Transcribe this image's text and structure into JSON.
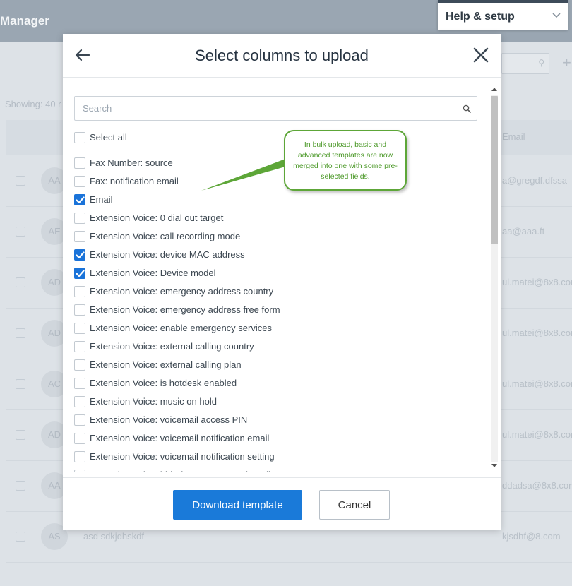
{
  "background": {
    "app_title": "Manager",
    "showing_text": "Showing: 40 r",
    "email_column_header": "Email",
    "rows": [
      {
        "avatar": "AA",
        "name": "",
        "email": "a@gregdf.dfssa"
      },
      {
        "avatar": "AE",
        "name": "",
        "email": "aa@aaa.ft"
      },
      {
        "avatar": "AD",
        "name": "",
        "email": "ul.matei@8x8.com"
      },
      {
        "avatar": "AD",
        "name": "",
        "email": "ul.matei@8x8.com"
      },
      {
        "avatar": "AC",
        "name": "",
        "email": "ul.matei@8x8.com"
      },
      {
        "avatar": "AD",
        "name": "",
        "email": "ul.matei@8x8.com"
      },
      {
        "avatar": "AA",
        "name": "",
        "email": "ddadsa@8x8.com"
      },
      {
        "avatar": "AS",
        "name": "asd sdkjdhskdf",
        "email": "kjsdhf@8.com"
      }
    ]
  },
  "help_menu": {
    "label": "Help & setup"
  },
  "modal": {
    "title": "Select columns to upload",
    "search_placeholder": "Search",
    "select_all_label": "Select all",
    "items": [
      {
        "label": "Fax Number: source",
        "checked": false
      },
      {
        "label": "Fax: notification email",
        "checked": false
      },
      {
        "label": "Email",
        "checked": true
      },
      {
        "label": "Extension Voice: 0 dial out target",
        "checked": false
      },
      {
        "label": "Extension Voice: call recording mode",
        "checked": false
      },
      {
        "label": "Extension Voice: device MAC address",
        "checked": true
      },
      {
        "label": "Extension Voice: Device model",
        "checked": true
      },
      {
        "label": "Extension Voice: emergency address country",
        "checked": false
      },
      {
        "label": "Extension Voice: emergency address free form",
        "checked": false
      },
      {
        "label": "Extension Voice: enable emergency services",
        "checked": false
      },
      {
        "label": "Extension Voice: external calling country",
        "checked": false
      },
      {
        "label": "Extension Voice: external calling plan",
        "checked": false
      },
      {
        "label": "Extension Voice: is hotdesk enabled",
        "checked": false
      },
      {
        "label": "Extension Voice: music on hold",
        "checked": false
      },
      {
        "label": "Extension Voice: voicemail access PIN",
        "checked": false
      },
      {
        "label": "Extension Voice: voicemail notification email",
        "checked": false
      },
      {
        "label": "Extension Voice: voicemail notification setting",
        "checked": false
      },
      {
        "label": "Extension Voice: hide from Auto Attendant directory",
        "checked": false
      }
    ],
    "download_button": "Download template",
    "cancel_button": "Cancel"
  },
  "callout": {
    "text": "In bulk upload, basic and advanced templates are now merged into one with some pre-selected fields."
  },
  "colors": {
    "primary": "#1a7ad9",
    "checkbox_checked": "#1a73d9",
    "callout_green": "#5da638",
    "title_text": "#263341"
  },
  "icons": {
    "back": "arrow-left-icon",
    "close": "close-icon",
    "search": "search-icon",
    "help_chevron": "chevron-down-icon"
  }
}
